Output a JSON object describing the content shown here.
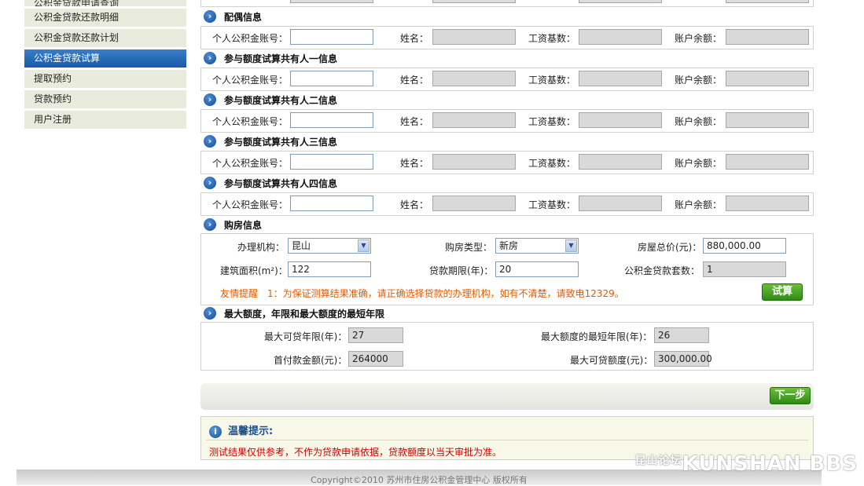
{
  "sidebar": {
    "items": [
      {
        "label": "公积金贷款申请查询"
      },
      {
        "label": "公积金贷款还款明细"
      },
      {
        "label": "公积金贷款还款计划"
      },
      {
        "label": "公积金贷款试算"
      },
      {
        "label": "提取预约"
      },
      {
        "label": "贷款预约"
      },
      {
        "label": "用户注册"
      }
    ]
  },
  "fields": {
    "account_label": "个人公积金账号：",
    "name_label": "姓名：",
    "salary_label": "工资基数：",
    "balance_label": "账户余额："
  },
  "sections": [
    {
      "title": "配偶信息"
    },
    {
      "title": "参与额度试算共有人一信息"
    },
    {
      "title": "参与额度试算共有人二信息"
    },
    {
      "title": "参与额度试算共有人三信息"
    },
    {
      "title": "参与额度试算共有人四信息"
    }
  ],
  "purchase": {
    "title": "购房信息",
    "agency_label": "办理机构：",
    "agency_value": "昆山",
    "type_label": "购房类型：",
    "type_value": "新房",
    "price_label": "房屋总价(元)：",
    "price_value": "880,000.00",
    "area_label": "建筑面积(m²)：",
    "area_value": "122",
    "term_label": "贷款期限(年)：",
    "term_value": "20",
    "count_label": "公积金贷款套数：",
    "count_value": "1",
    "tip": "友情提醒　1：为保证测算结果准确，请正确选择贷款的办理机构，如有不清楚，请致电12329。",
    "calc_button": "试算"
  },
  "result": {
    "title": "最大额度，年限和最大额度的最短年限",
    "max_years_label": "最大可贷年限(年)：",
    "max_years_value": "27",
    "min_years_label": "最大额度的最短年限(年)：",
    "min_years_value": "26",
    "down_label": "首付款金额(元)：",
    "down_value": "264000",
    "max_amount_label": "最大可贷额度(元)：",
    "max_amount_value": "300,000.00"
  },
  "next_button": "下一步",
  "notice": {
    "title": "温馨提示:",
    "body": "测试结果仅供参考，不作为贷款申请依据，贷款额度以当天审批为准。"
  },
  "footer": "Copyright©2010  苏州市住房公积金管理中心  版权所有",
  "watermark": {
    "small": "昆山论坛",
    "big": "KUNSHAN BBS"
  }
}
